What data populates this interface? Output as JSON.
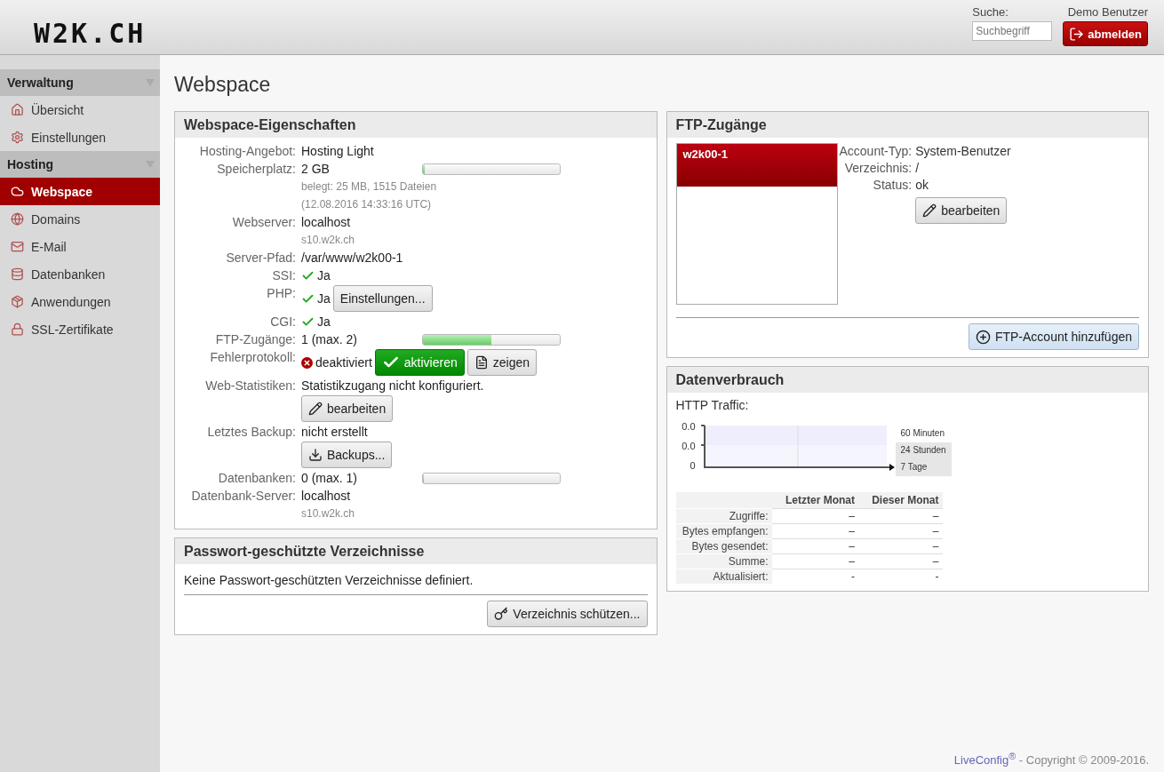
{
  "header": {
    "logo": "W2K.CH",
    "search_label": "Suche:",
    "search": {
      "placeholder": "Suchbegriff"
    },
    "user": "Demo Benutzer",
    "logout_button": "abmelden"
  },
  "sidebar": {
    "sections": [
      {
        "title": "Verwaltung",
        "items": [
          {
            "label": "Übersicht",
            "selected": false
          },
          {
            "label": "Einstellungen",
            "selected": false
          }
        ]
      },
      {
        "title": "Hosting",
        "items": [
          {
            "label": "Webspace",
            "selected": true
          },
          {
            "label": "Domains",
            "selected": false
          },
          {
            "label": "E-Mail",
            "selected": false
          },
          {
            "label": "Datenbanken",
            "selected": false
          },
          {
            "label": "Anwendungen",
            "selected": false
          },
          {
            "label": "SSL-Zertifikate",
            "selected": false
          }
        ]
      }
    ]
  },
  "page_title": "Webspace",
  "properties_panel": {
    "title": "Webspace-Eigenschaften",
    "rows": [
      {
        "label": "Hosting-Angebot:",
        "kind": "text",
        "value": "Hosting Light"
      },
      {
        "label": "Speicherplatz:",
        "kind": "text",
        "value": "2 GB",
        "level": 0.01,
        "notes": [
          "belegt: 25 MB, 1515 Dateien",
          "(12.08.2016 14:33:16 UTC)"
        ]
      },
      {
        "label": "Webserver:",
        "kind": "text",
        "value": "localhost",
        "notes": [
          "s10.w2k.ch"
        ]
      },
      {
        "label": "Server-Pfad:",
        "kind": "text",
        "value": "/var/www/w2k00-1"
      },
      {
        "label": "SSI:",
        "kind": "check",
        "value": "Ja"
      },
      {
        "label": "PHP:",
        "kind": "check",
        "value": "Ja",
        "buttons": [
          {
            "label": "Einstellungen...",
            "kind": "plain"
          }
        ]
      },
      {
        "label": "CGI:",
        "kind": "check",
        "value": "Ja"
      },
      {
        "label": "FTP-Zugänge:",
        "kind": "text",
        "value": "1 (max. 2)",
        "level": 0.5
      },
      {
        "label": "Fehlerprotokoll:",
        "kind": "error",
        "value": "deaktiviert",
        "buttons": [
          {
            "label": "aktivieren",
            "kind": "activate"
          },
          {
            "label": "zeigen",
            "kind": "show"
          }
        ]
      },
      {
        "label": "Web-Statistiken:",
        "kind": "stacked",
        "value": "Statistikzugang nicht konfiguriert.",
        "buttons": [
          {
            "label": "bearbeiten",
            "kind": "edit"
          }
        ]
      },
      {
        "label": "Letztes Backup:",
        "kind": "stacked",
        "value": "nicht erstellt",
        "buttons": [
          {
            "label": "Backups...",
            "kind": "download"
          }
        ]
      },
      {
        "label": "Datenbanken:",
        "kind": "text",
        "value": "0 (max. 1)",
        "level": 0
      },
      {
        "label": "Datenbank-Server:",
        "kind": "text",
        "value": "localhost",
        "notes": [
          "s10.w2k.ch"
        ]
      }
    ]
  },
  "protected_dirs_panel": {
    "title": "Passwort-geschützte Verzeichnisse",
    "message": "Keine Passwort-geschützten Verzeichnisse definiert.",
    "button": {
      "label": "Verzeichnis schützen...",
      "kind": "protect"
    }
  },
  "ftp_panel": {
    "title": "FTP-Zugänge",
    "accounts": [
      {
        "label": "w2k00-1",
        "selected": true
      }
    ],
    "details": [
      {
        "label": "Account-Typ:",
        "value": "System-Benutzer"
      },
      {
        "label": "Verzeichnis:",
        "value": "/"
      },
      {
        "label": "Status:",
        "value": "ok"
      }
    ],
    "edit_button": {
      "label": "bearbeiten",
      "kind": "edit"
    },
    "add_button": {
      "label": "FTP-Account hinzufügen",
      "kind": "add"
    }
  },
  "traffic_panel": {
    "title": "Datenverbrauch",
    "chart_label": "HTTP Traffic:",
    "y_labels": [
      "0.0",
      "0.0",
      "0"
    ],
    "ranges": [
      {
        "label": "60 Minuten",
        "selected": true
      },
      {
        "label": "24 Stunden",
        "selected": false
      },
      {
        "label": "7 Tage",
        "selected": false
      }
    ],
    "table": {
      "columns": [
        "Letzter Monat",
        "Dieser Monat"
      ],
      "rows": [
        {
          "label": "Zugriffe:",
          "cells": [
            "–",
            "–"
          ]
        },
        {
          "label": "Bytes empfangen:",
          "cells": [
            "–",
            "–"
          ]
        },
        {
          "label": "Bytes gesendet:",
          "cells": [
            "–",
            "–"
          ]
        },
        {
          "label": "Summe:",
          "cells": [
            "–",
            "–"
          ]
        },
        {
          "label": "Aktualisiert:",
          "cells": [
            "-",
            "-"
          ]
        }
      ]
    }
  },
  "footer": {
    "brand": "LiveConfig$^{®}$",
    "copyright": " - Copyright © 2009-2016."
  }
}
